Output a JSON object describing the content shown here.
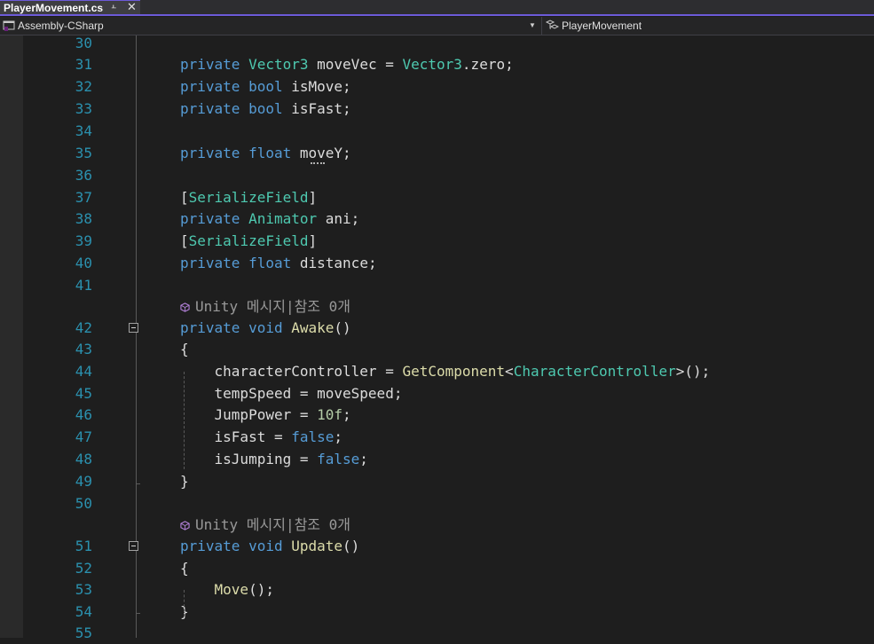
{
  "tab": {
    "title": "PlayerMovement.cs",
    "pin_icon": "pin-icon",
    "close_icon": "close-icon"
  },
  "nav": {
    "project": "Assembly-CSharp",
    "class": "PlayerMovement"
  },
  "code_lines": [
    {
      "num": "30"
    },
    {
      "num": "31",
      "tokens": [
        {
          "t": "private",
          "c": "kw"
        },
        {
          "t": " "
        },
        {
          "t": "Vector3",
          "c": "ty"
        },
        {
          "t": " moveVec = "
        },
        {
          "t": "Vector3",
          "c": "ty"
        },
        {
          "t": ".zero;"
        }
      ]
    },
    {
      "num": "32",
      "tokens": [
        {
          "t": "private",
          "c": "kw"
        },
        {
          "t": " "
        },
        {
          "t": "bool",
          "c": "kw"
        },
        {
          "t": " isMove;"
        }
      ]
    },
    {
      "num": "33",
      "tokens": [
        {
          "t": "private",
          "c": "kw"
        },
        {
          "t": " "
        },
        {
          "t": "bool",
          "c": "kw"
        },
        {
          "t": " isFast;"
        }
      ]
    },
    {
      "num": "34"
    },
    {
      "num": "35",
      "tokens": [
        {
          "t": "private",
          "c": "kw"
        },
        {
          "t": " "
        },
        {
          "t": "float",
          "c": "kw"
        },
        {
          "t": " moveY;"
        }
      ]
    },
    {
      "num": "36"
    },
    {
      "num": "37",
      "tokens": [
        {
          "t": "["
        },
        {
          "t": "SerializeField",
          "c": "ty"
        },
        {
          "t": "]"
        }
      ]
    },
    {
      "num": "38",
      "tokens": [
        {
          "t": "private",
          "c": "kw"
        },
        {
          "t": " "
        },
        {
          "t": "Animator",
          "c": "ty"
        },
        {
          "t": " ani;"
        }
      ]
    },
    {
      "num": "39",
      "tokens": [
        {
          "t": "["
        },
        {
          "t": "SerializeField",
          "c": "ty"
        },
        {
          "t": "]"
        }
      ]
    },
    {
      "num": "40",
      "tokens": [
        {
          "t": "private",
          "c": "kw"
        },
        {
          "t": " "
        },
        {
          "t": "float",
          "c": "kw"
        },
        {
          "t": " distance;"
        }
      ]
    },
    {
      "num": "41"
    },
    {
      "num": "42",
      "tokens": [
        {
          "t": "private",
          "c": "kw"
        },
        {
          "t": " "
        },
        {
          "t": "void",
          "c": "kw"
        },
        {
          "t": " "
        },
        {
          "t": "Awake",
          "c": "fn"
        },
        {
          "t": "()"
        }
      ]
    },
    {
      "num": "43",
      "tokens": [
        {
          "t": "{"
        }
      ]
    },
    {
      "num": "44",
      "tokens": [
        {
          "t": "    characterController = "
        },
        {
          "t": "GetComponent",
          "c": "fn"
        },
        {
          "t": "<"
        },
        {
          "t": "CharacterController",
          "c": "ty"
        },
        {
          "t": ">();"
        }
      ]
    },
    {
      "num": "45",
      "tokens": [
        {
          "t": "    tempSpeed = moveSpeed;"
        }
      ]
    },
    {
      "num": "46",
      "tokens": [
        {
          "t": "    JumpPower = "
        },
        {
          "t": "10f",
          "c": "nu"
        },
        {
          "t": ";"
        }
      ]
    },
    {
      "num": "47",
      "tokens": [
        {
          "t": "    isFast = "
        },
        {
          "t": "false",
          "c": "kw"
        },
        {
          "t": ";"
        }
      ]
    },
    {
      "num": "48",
      "tokens": [
        {
          "t": "    isJumping = "
        },
        {
          "t": "false",
          "c": "kw"
        },
        {
          "t": ";"
        }
      ]
    },
    {
      "num": "49",
      "tokens": [
        {
          "t": "}"
        }
      ]
    },
    {
      "num": "50"
    },
    {
      "num": "51",
      "tokens": [
        {
          "t": "private",
          "c": "kw"
        },
        {
          "t": " "
        },
        {
          "t": "void",
          "c": "kw"
        },
        {
          "t": " "
        },
        {
          "t": "Update",
          "c": "fn"
        },
        {
          "t": "()"
        }
      ]
    },
    {
      "num": "52",
      "tokens": [
        {
          "t": "{"
        }
      ]
    },
    {
      "num": "53",
      "tokens": [
        {
          "t": "    "
        },
        {
          "t": "Move",
          "c": "fn"
        },
        {
          "t": "();"
        }
      ]
    },
    {
      "num": "54",
      "tokens": [
        {
          "t": "}"
        }
      ]
    },
    {
      "num": "55"
    }
  ],
  "codelens": [
    {
      "text": "Unity 메시지|참조 0개"
    },
    {
      "text": "Unity 메시지|참조 0개"
    }
  ],
  "colors": {
    "keyword": "#569cd6",
    "type": "#4ec9b0",
    "method": "#dcdcaa",
    "number": "#b5cea8",
    "line_number": "#2b91af",
    "accent": "#6c5ad8"
  }
}
